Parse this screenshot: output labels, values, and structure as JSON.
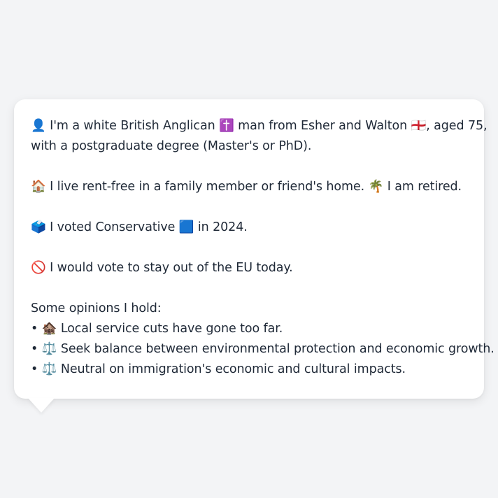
{
  "card": {
    "identity_line1": "👤 I'm a white British Anglican ✝️ man from Esher and Walton 🏴󠁧󠁢󠁥󠁮󠁧󠁿, aged 75,",
    "identity_line2": "with a postgraduate degree (Master's or PhD).",
    "housing_line": "🏠 I live rent-free in a family member or friend's home. 🌴 I am retired.",
    "vote_line": "🗳️ I voted Conservative 🟦 in 2024.",
    "eu_line": "🚫 I would vote to stay out of the EU today.",
    "opinions_heading": "Some opinions I hold:",
    "opinions": [
      "• 🏚️ Local service cuts have gone too far.",
      "• ⚖️ Seek balance between environmental protection and economic growth.",
      "• ⚖️ Neutral on immigration's economic and cultural impacts."
    ]
  }
}
